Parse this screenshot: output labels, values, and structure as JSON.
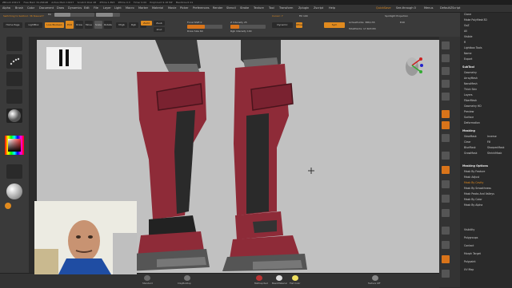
{
  "titlebar": {
    "app": "ZBrush 2021.5",
    "items": [
      "Free Mem 34.264GB",
      "Active Mem 10217",
      "Scratch Disk 48",
      "ZTime 1.893",
      "RTime 0.3",
      "Timer 0.00",
      "PolyCount 9.18 MP",
      "MeshCount 21"
    ]
  },
  "menubar": {
    "items": [
      "Alpha",
      "Brush",
      "Color",
      "Document",
      "Draw",
      "Dynamics",
      "Edit",
      "File",
      "Layer",
      "Light",
      "Macro",
      "Marker",
      "Material",
      "Movie",
      "Picker",
      "Preferences",
      "Render",
      "Stencil",
      "Stroke",
      "Texture",
      "Tool",
      "Transform",
      "Zplugin",
      "Zscript",
      "Help"
    ],
    "right": [
      "QuickSave",
      "See-through 0",
      "Menus",
      "DefaultZScript"
    ]
  },
  "topbar": {
    "left_label": "Switching to Subtool: 36 Sleeve??",
    "buttons": [
      "Home Page",
      "LightBox",
      "Live Boolean",
      "Edit",
      "Draw",
      "Move",
      "Scale",
      "Rotate"
    ],
    "mrgb": "Mrgb",
    "rgb": "Rgb",
    "m": "M",
    "zadd": "Zadd",
    "zsub": "Zsub",
    "zcut": "Zcut",
    "focal_label": "Focal Shift 0",
    "draw_size_label": "Draw Size 64",
    "z_intensity_label": "Z Intensity 25",
    "rgb_intensity_label": "Rgb Intensity 100",
    "dynamic": "Dynamic",
    "active_points": "ActivePoints: 388,155",
    "total_points": "TotalPoints: 17.603 Mil",
    "spotlight": "Spotlight Projection",
    "cursor_readout": "Cursor: 7",
    "fill_label": "Fill",
    "edit_label": "Edit",
    "xpose": "XPose",
    "symmetry": "Sym",
    "fill_value": "Fill 100"
  },
  "right_panel": {
    "top_items": [
      "Clone",
      "Make PolyMesh3D",
      "GoZ",
      "All",
      "Visible",
      "R",
      "Lightbox Tools",
      "Name",
      "Export"
    ],
    "groups": [
      {
        "header": "SubTool",
        "items": [
          "Geometry",
          "ArrayMesh",
          "NanoMesh",
          "Thick Skin",
          "Layers",
          "FiberMesh",
          "Geometry HD",
          "Preview",
          "Surface",
          "Deformation"
        ]
      },
      {
        "header": "Masking",
        "items": [
          "ViewMask",
          "Inverse",
          "Clear",
          "Fill",
          "BlurMask",
          "SharpenMask",
          "GrowMask",
          "ShrinkMask"
        ]
      },
      {
        "header": "Masking Options",
        "items": [
          "Mask By Feature",
          "Mask Adjust",
          "Mask By Cavity",
          "Mask By Smoothness",
          "Mask Peaks And Valleys",
          "Mask By Color",
          "Mask By Alpha",
          "Visibility",
          "Polygroups",
          "Contact",
          "Morph Target",
          "Polypaint",
          "UV Map"
        ]
      }
    ]
  },
  "bottombar": {
    "items": [
      "Standard",
      "ClayBuildup",
      "Move",
      "Inflate",
      "hPolish",
      "TrimDynamic",
      "Pinch",
      "Layer",
      "DamStandard",
      "Move Topological",
      "Dots",
      "Zadd",
      "Flat Color",
      "MatCap Red",
      "BasicMaterial",
      "Texture Off",
      "MatCap Gray",
      "Alpha Off",
      "Polish"
    ]
  },
  "colors": {
    "accent": "#e08a1e",
    "canvas": "#c1c1c1",
    "boot_red": "#8e2b38",
    "boot_dark": "#2a2a2a",
    "sole": "#5b5b5b"
  }
}
